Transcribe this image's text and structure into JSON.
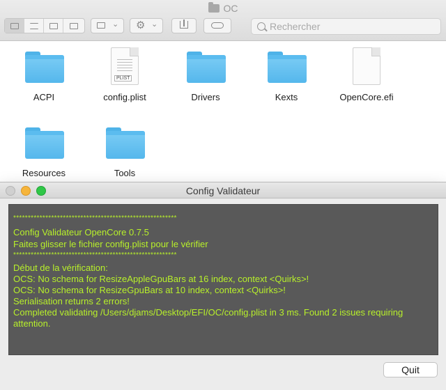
{
  "finder": {
    "title": "OC",
    "search_placeholder": "Rechercher",
    "items": [
      {
        "label": "ACPI",
        "icon": "folder-icon"
      },
      {
        "label": "config.plist",
        "icon": "plist-file-icon",
        "badge": "PLIST"
      },
      {
        "label": "Drivers",
        "icon": "folder-icon"
      },
      {
        "label": "Kexts",
        "icon": "folder-icon"
      },
      {
        "label": "OpenCore.efi",
        "icon": "file-icon"
      },
      {
        "label": "Resources",
        "icon": "folder-icon"
      },
      {
        "label": "Tools",
        "icon": "folder-icon"
      }
    ]
  },
  "validator": {
    "title": "Config Validateur",
    "lines": [
      "********************************************************",
      "Config Validateur OpenCore 0.7.5",
      "Faites glisser le fichier config.plist pour le vérifier",
      "********************************************************",
      "Début de la vérification:",
      "OCS: No schema for ResizeAppleGpuBars at 16 index, context <Quirks>!",
      "OCS: No schema for ResizeGpuBars at 10 index, context <Quirks>!",
      "Serialisation returns 2 errors!",
      "Completed validating /Users/djams/Desktop/EFI/OC/config.plist in 3 ms. Found 2 issues requiring",
      "attention."
    ],
    "quit_label": "Quit",
    "text_color": "#b8f12a",
    "console_bg": "#595959"
  }
}
